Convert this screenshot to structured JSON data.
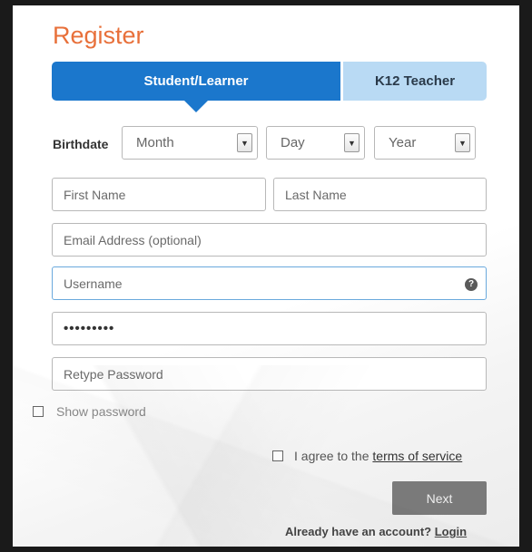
{
  "title": "Register",
  "tabs": {
    "student": "Student/Learner",
    "teacher": "K12 Teacher"
  },
  "birthdate": {
    "label": "Birthdate",
    "month": "Month",
    "day": "Day",
    "year": "Year",
    "arrow_icon": "chevron-down-icon"
  },
  "fields": {
    "first_name_placeholder": "First Name",
    "last_name_placeholder": "Last Name",
    "email_placeholder": "Email Address (optional)",
    "username_placeholder": "Username",
    "password_value": "•••••••••",
    "retype_placeholder": "Retype Password"
  },
  "help_icon_glyph": "?",
  "show_password_label": "Show password",
  "agree": {
    "prefix": "I agree to the ",
    "link": "terms of service"
  },
  "next_label": "Next",
  "login": {
    "prefix": "Already have an account? ",
    "link": "Login"
  },
  "colors": {
    "accent_orange": "#e8703a",
    "active_tab": "#1b77cc",
    "inactive_tab": "#b9daf4",
    "next_button": "#7a7a7a"
  }
}
